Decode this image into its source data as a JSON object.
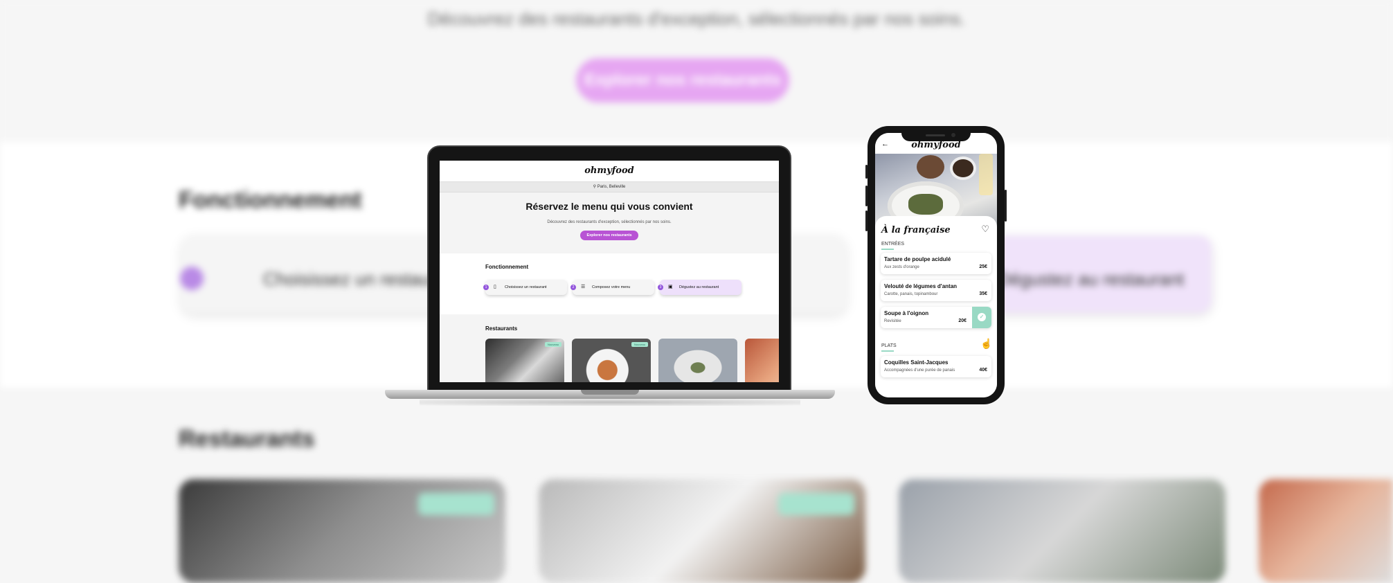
{
  "background_page": {
    "subtitle": "Découvrez des restaurants d'exception, sélectionnés par nos soins.",
    "cta": "Explorer nos restaurants",
    "section_how": "Fonctionnement",
    "step_left": "Choisissez un restaurant",
    "step_right": "Dégustez au restaurant",
    "section_restaurants": "Restaurants"
  },
  "laptop_site": {
    "logo": "ohmyfood",
    "location": "Paris, Belleville",
    "headline": "Réservez le menu qui vous convient",
    "subtitle": "Découvrez des restaurants d'exception, sélectionnés par nos soins.",
    "cta": "Explorer nos restaurants",
    "section_how": "Fonctionnement",
    "steps": [
      {
        "num": "1",
        "label": "Choisissez un restaurant"
      },
      {
        "num": "2",
        "label": "Composez votre menu"
      },
      {
        "num": "3",
        "label": "Dégustez au restaurant"
      }
    ],
    "section_restaurants": "Restaurants",
    "badge_new": "Nouveau"
  },
  "phone_app": {
    "logo": "ohmyfood",
    "restaurant_title": "À la française",
    "sections": [
      {
        "title": "ENTRÉES",
        "items": [
          {
            "name": "Tartare de poulpe acidulé",
            "desc": "Aux zests d'orange",
            "price": "25€"
          },
          {
            "name": "Velouté de légumes d'antan",
            "desc": "Carotte, panais, topinambour",
            "price": "35€"
          },
          {
            "name": "Soupe à l'oignon",
            "desc": "Revisitée",
            "price": "20€",
            "selected": true
          }
        ]
      },
      {
        "title": "PLATS",
        "items": [
          {
            "name": "Coquilles Saint-Jacques",
            "desc": "Accompagnées d'une purée de panais",
            "price": "40€"
          }
        ]
      }
    ]
  },
  "colors": {
    "brand_purple": "#9356dc",
    "brand_pink": "#b853d4",
    "mint": "#99d9c4"
  }
}
